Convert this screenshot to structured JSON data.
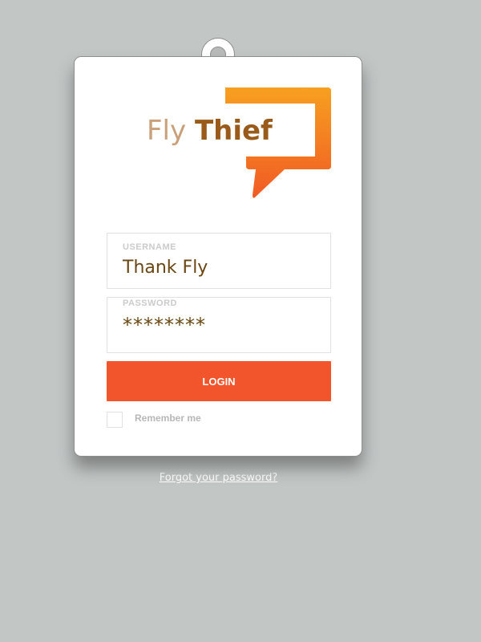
{
  "logo": {
    "word1": "Fly",
    "word2": "Thief",
    "icon": "speech-bubble-icon",
    "gradient_top": "#f7a020",
    "gradient_bottom": "#f15a24"
  },
  "form": {
    "username": {
      "label": "USERNAME",
      "value": "Thank Fly"
    },
    "password": {
      "label": "PASSWORD",
      "value": "********"
    },
    "login_label": "LOGIN",
    "remember_label": "Remember me",
    "remember_checked": false
  },
  "forgot_link": "Forgot your password?",
  "colors": {
    "background": "#c2c6c5",
    "accent": "#f2552c",
    "value_text": "#6a4612"
  }
}
